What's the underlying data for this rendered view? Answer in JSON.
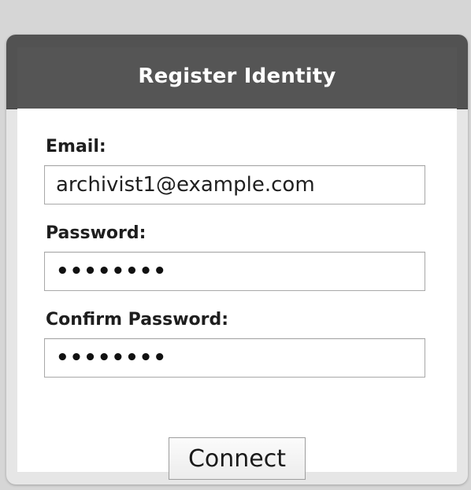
{
  "dialog": {
    "title": "Register Identity"
  },
  "form": {
    "email": {
      "label": "Email:",
      "value": "archivist1@example.com"
    },
    "password": {
      "label": "Password:",
      "value": "••••••••"
    },
    "confirm_password": {
      "label": "Confirm Password:",
      "value": "••••••••"
    },
    "submit_label": "Connect"
  },
  "colors": {
    "header_background": "#555555",
    "page_background": "#d6d6d6"
  }
}
